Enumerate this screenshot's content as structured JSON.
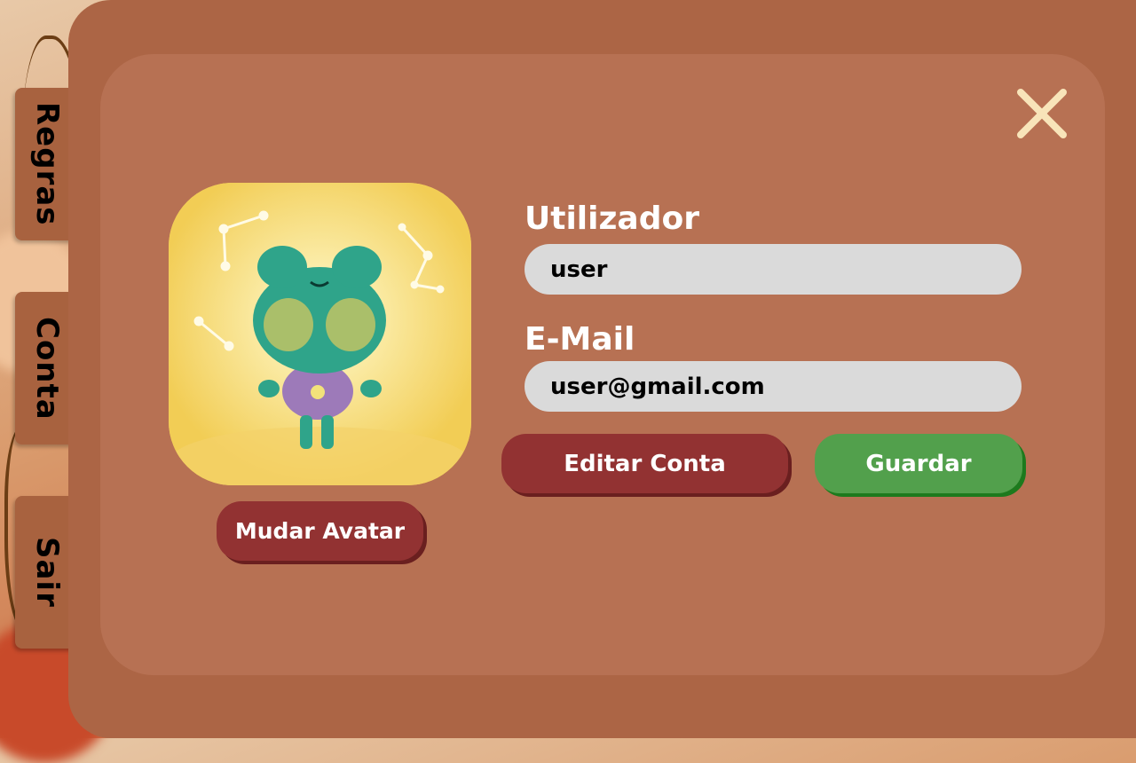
{
  "sidebar": {
    "tabs": [
      {
        "label": "Regras"
      },
      {
        "label": "Conta"
      },
      {
        "label": "Sair"
      }
    ]
  },
  "profile": {
    "avatar_alt": "frog-avatar",
    "change_avatar_label": "Mudar Avatar"
  },
  "form": {
    "username_label": "Utilizador",
    "username_value": "user",
    "email_label": "E-Mail",
    "email_value": "user@gmail.com",
    "edit_button_label": "Editar Conta",
    "save_button_label": "Guardar"
  },
  "colors": {
    "panel": "#ac6545",
    "panel_inner": "#b77153",
    "red_button": "#923232",
    "green_button": "#52a04c",
    "field": "#dadada",
    "close_icon": "#f8e4b9"
  },
  "icons": {
    "close": "close-icon"
  }
}
